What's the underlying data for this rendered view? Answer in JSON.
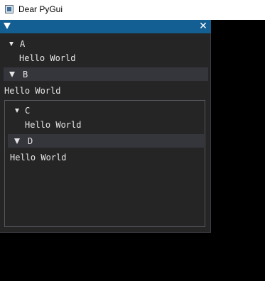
{
  "os_window": {
    "title": "Dear PyGui"
  },
  "window": {
    "close_glyph": "✕",
    "node_a": {
      "label": "A",
      "text": "Hello World"
    },
    "header_b": {
      "label": "B",
      "text": "Hello World"
    },
    "child": {
      "node_c": {
        "label": "C",
        "text": "Hello World"
      },
      "header_d": {
        "label": "D",
        "text": "Hello World"
      }
    }
  }
}
